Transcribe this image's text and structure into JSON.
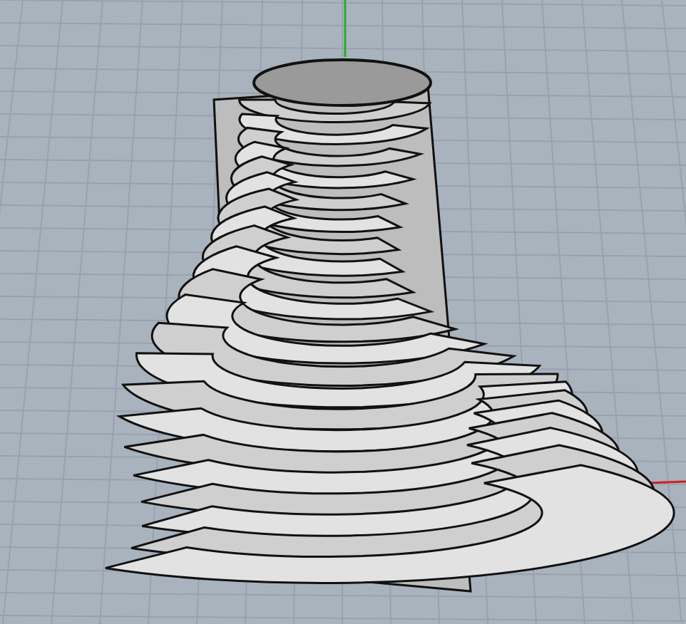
{
  "viewport": {
    "grid_visible": true,
    "axes_visible": true
  }
}
